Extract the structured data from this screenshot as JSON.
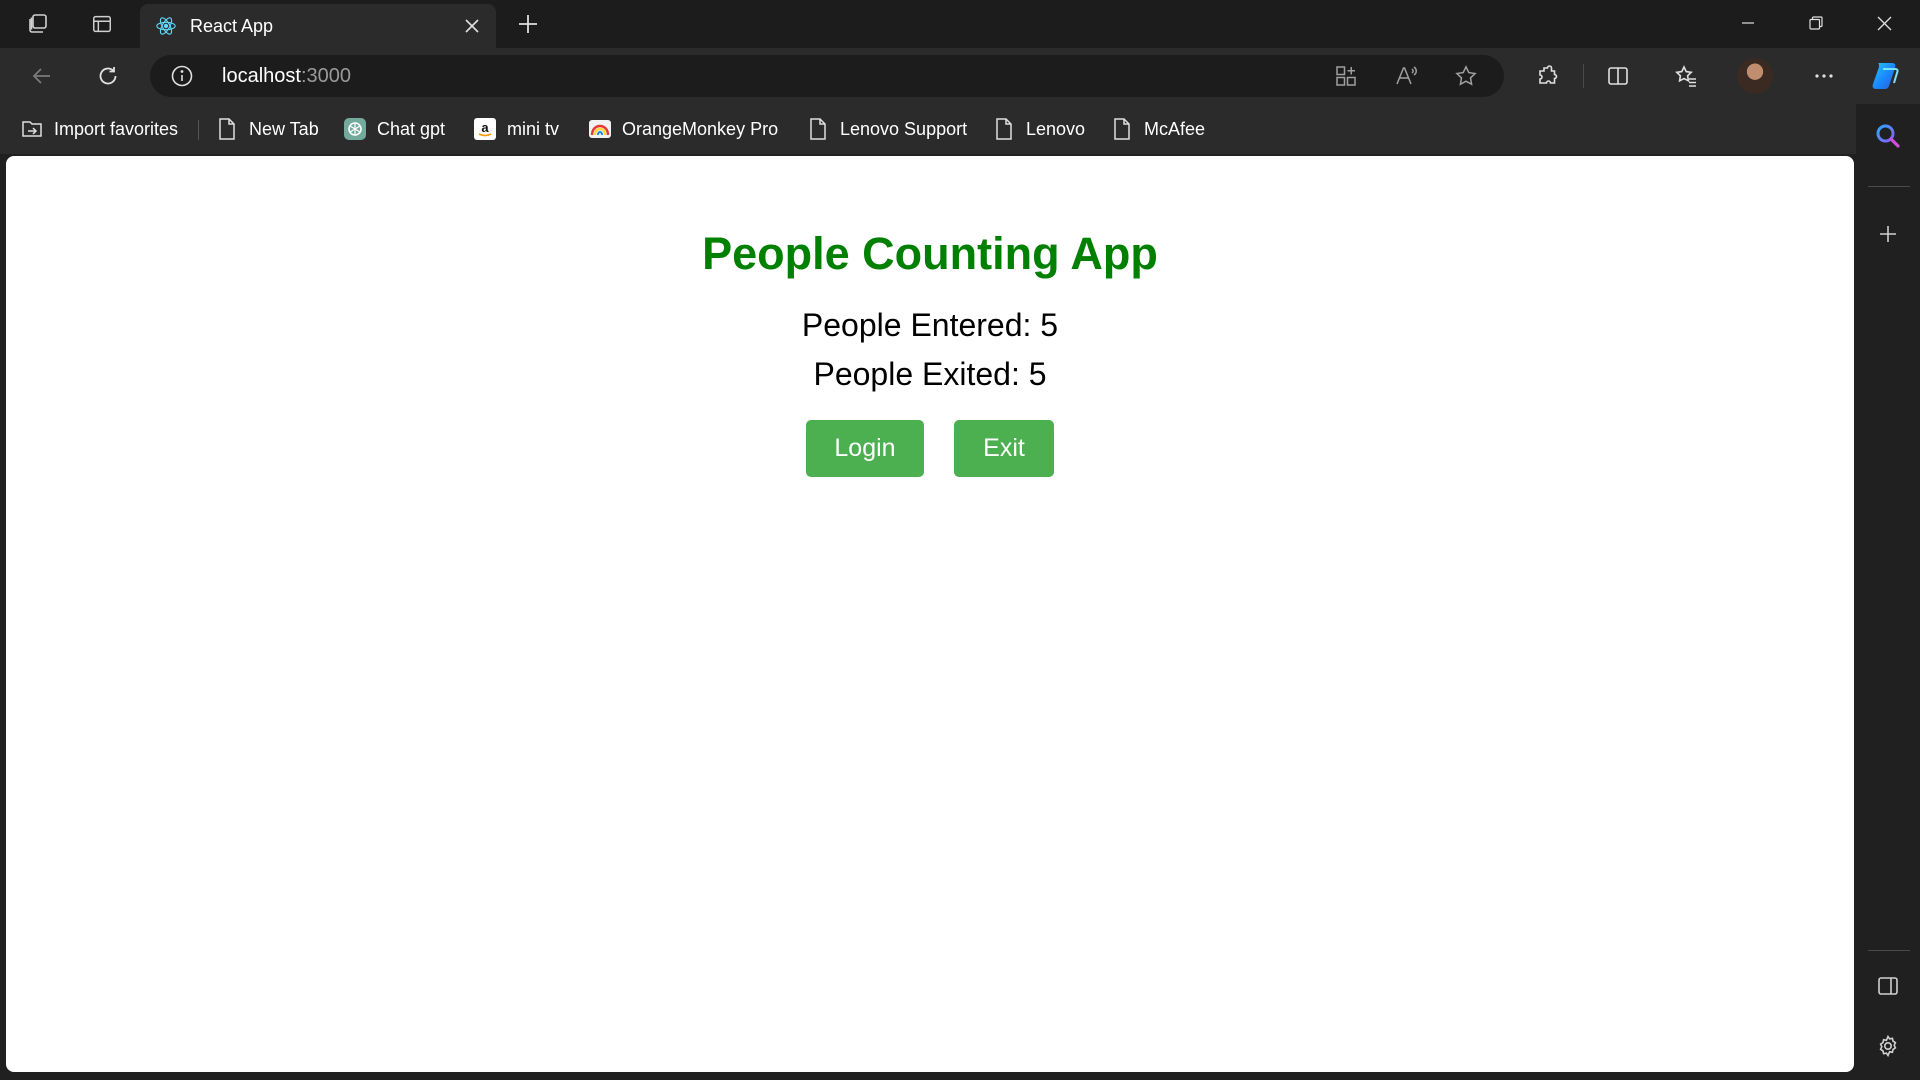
{
  "browser": {
    "tab": {
      "title": "React App",
      "favicon": "react-icon"
    },
    "address": {
      "host": "localhost",
      "port": ":3000"
    },
    "bookmarks": [
      {
        "label": "Import favorites",
        "icon": "import-favorites-icon"
      },
      {
        "label": "New Tab",
        "icon": "page-icon"
      },
      {
        "label": "Chat gpt",
        "icon": "chatgpt-icon"
      },
      {
        "label": "mini tv",
        "icon": "amazon-icon"
      },
      {
        "label": "OrangeMonkey Pro",
        "icon": "orangemonkey-icon"
      },
      {
        "label": "Lenovo Support",
        "icon": "page-icon"
      },
      {
        "label": "Lenovo",
        "icon": "page-icon"
      },
      {
        "label": "McAfee",
        "icon": "page-icon"
      }
    ],
    "colors": {
      "frame": "#1c1c1c",
      "toolbar": "#2b2b2b",
      "copilot_accent": "#1a8cff"
    }
  },
  "app": {
    "title": "People Counting App",
    "entered_text": "People Entered: 5",
    "exited_text": "People Exited: 5",
    "login_label": "Login",
    "exit_label": "Exit",
    "colors": {
      "title": "#008000",
      "button": "#4caf50"
    }
  }
}
